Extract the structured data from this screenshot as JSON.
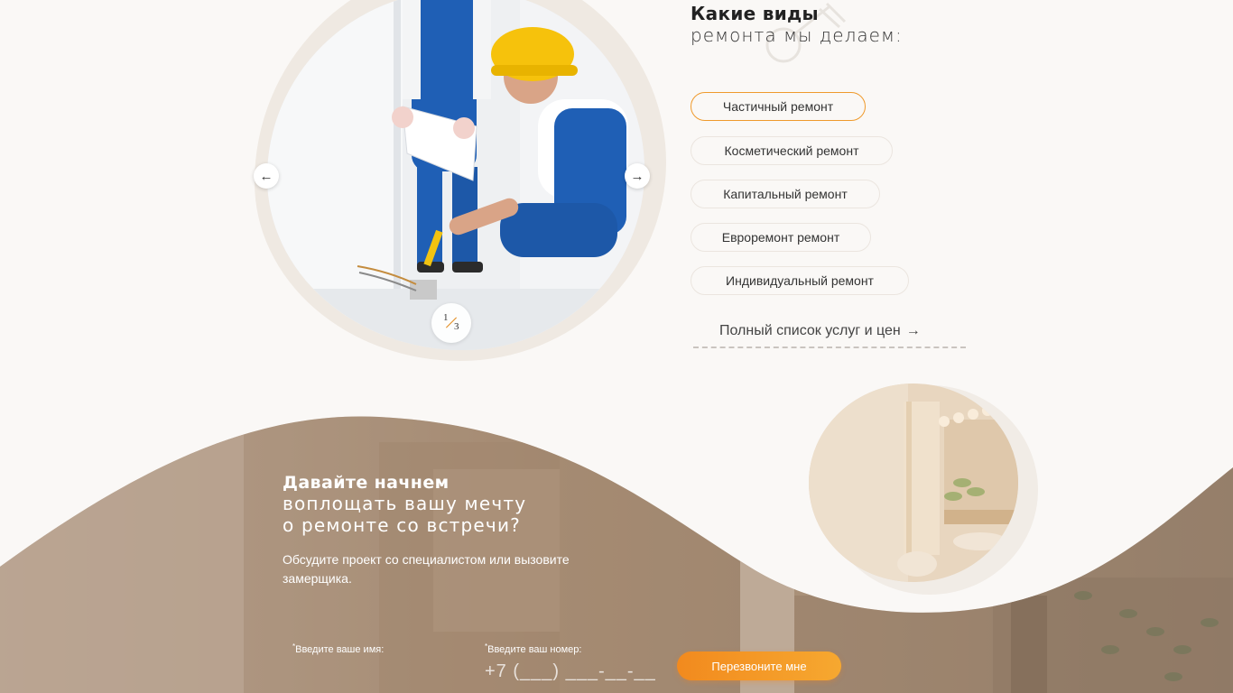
{
  "services": {
    "title_bold": "Какие виды",
    "title_light": "ремонта мы делаем:",
    "items": [
      {
        "label": "Частичный ремонт",
        "active": true
      },
      {
        "label": "Косметический ремонт",
        "active": false
      },
      {
        "label": "Капитальный ремонт",
        "active": false
      },
      {
        "label": "Евроремонт ремонт",
        "active": false
      },
      {
        "label": "Индивидуальный ремонт",
        "active": false
      }
    ],
    "full_list_label": "Полный список услуг и цен",
    "full_list_arrow": "→"
  },
  "slider": {
    "prev_icon": "←",
    "next_icon": "→",
    "current": "1",
    "total": "3"
  },
  "cta": {
    "title_bold": "Давайте начнем",
    "title_line2": "воплощать вашу мечту",
    "title_line3": "о ремонте со встречи?",
    "subtitle": "Обсудите проект со специалистом или вызовите замерщика.",
    "name_label": "Введите ваше имя:",
    "phone_label": "Введите ваш номер:",
    "required_mark": "*",
    "phone_mask": "+7 (___) ___-__-__",
    "button_label": "Перезвоните мне"
  },
  "colors": {
    "accent": "#f28a1e",
    "background": "#faf8f6",
    "pill_border": "#ebe5df"
  }
}
